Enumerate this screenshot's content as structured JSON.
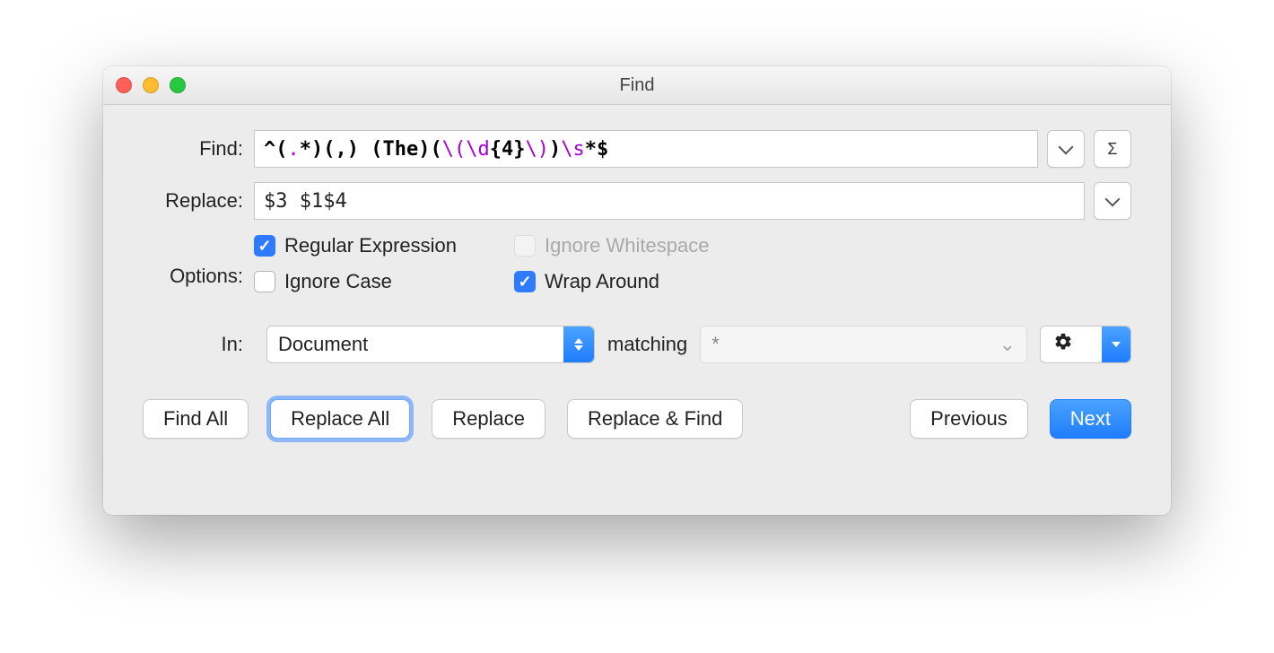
{
  "window": {
    "title": "Find"
  },
  "labels": {
    "find": "Find:",
    "replace": "Replace:",
    "options": "Options:",
    "in": "In:",
    "matching": "matching"
  },
  "find": {
    "value": "^(.*)(,) (The)( \\(\\d{4}\\))\\s*$",
    "tokens": [
      {
        "t": "^(",
        "c": "re-black"
      },
      {
        "t": ".",
        "c": "re-purple"
      },
      {
        "t": "*)(",
        "c": "re-black"
      },
      {
        "t": ",",
        "c": "re-black"
      },
      {
        "t": ") (The)(",
        "c": "re-black"
      },
      {
        "t": " \\(\\d",
        "c": "re-purple"
      },
      {
        "t": "{4}",
        "c": "re-black re-bold"
      },
      {
        "t": "\\)",
        "c": "re-purple"
      },
      {
        "t": ")",
        "c": "re-black"
      },
      {
        "t": "\\s",
        "c": "re-purple"
      },
      {
        "t": "*$",
        "c": "re-black re-bold"
      }
    ]
  },
  "replace": {
    "value": "$3 $1$4"
  },
  "options": {
    "regular_expression": {
      "label": "Regular Expression",
      "checked": true,
      "disabled": false
    },
    "ignore_whitespace": {
      "label": "Ignore Whitespace",
      "checked": false,
      "disabled": true
    },
    "ignore_case": {
      "label": "Ignore Case",
      "checked": false,
      "disabled": false
    },
    "wrap_around": {
      "label": "Wrap Around",
      "checked": true,
      "disabled": false
    }
  },
  "scope": {
    "select_value": "Document",
    "matching_placeholder": "*"
  },
  "sigma": "Σ",
  "buttons": {
    "find_all": "Find All",
    "replace_all": "Replace All",
    "replace": "Replace",
    "replace_find": "Replace & Find",
    "previous": "Previous",
    "next": "Next"
  }
}
